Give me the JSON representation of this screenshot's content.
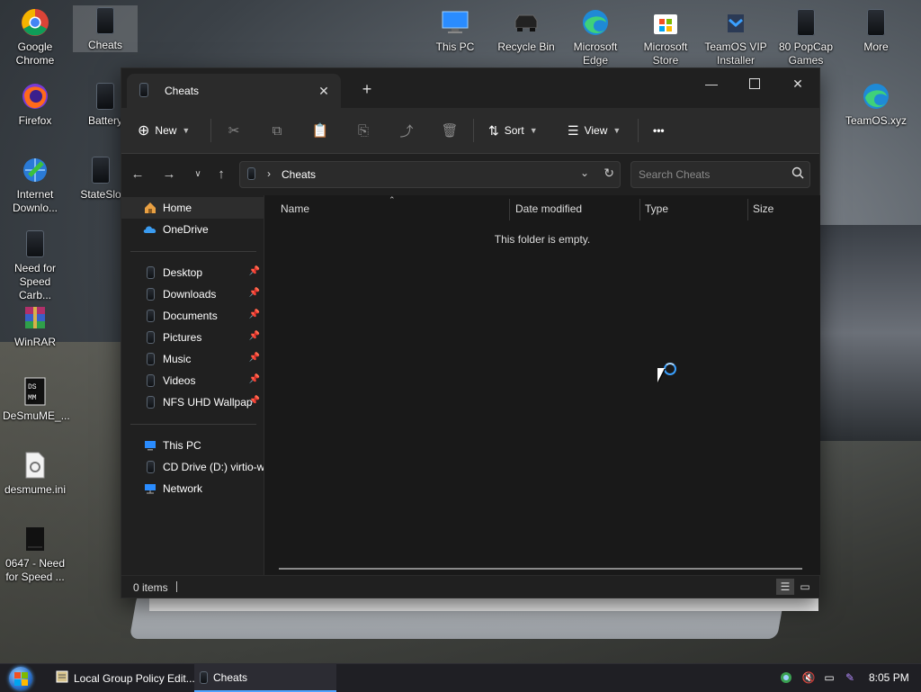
{
  "desktop": {
    "icons": [
      {
        "label": "Google\nChrome"
      },
      {
        "label": "Cheats"
      },
      {
        "label": "Firefox"
      },
      {
        "label": "Battery"
      },
      {
        "label": "Internet\nDownlo..."
      },
      {
        "label": "StateSlo"
      },
      {
        "label": "Need for\nSpeed Carb..."
      },
      {
        "label": "WinRAR"
      },
      {
        "label": "DeSmuME_..."
      },
      {
        "label": "desmume.ini"
      },
      {
        "label": "0647 - Need\nfor Speed ..."
      },
      {
        "label": "This PC"
      },
      {
        "label": "Recycle Bin"
      },
      {
        "label": "Microsoft\nEdge"
      },
      {
        "label": "Microsoft\nStore"
      },
      {
        "label": "TeamOS VIP\nInstaller"
      },
      {
        "label": "80 PopCap\nGames"
      },
      {
        "label": "More"
      },
      {
        "label": "TeamOS.xyz"
      }
    ]
  },
  "explorer": {
    "tab_title": "Cheats",
    "toolbar": {
      "new_label": "New",
      "sort_label": "Sort",
      "view_label": "View",
      "more_label": "•••"
    },
    "address": {
      "path": "Cheats",
      "search_placeholder": "Search Cheats"
    },
    "nav": {
      "quick": [
        {
          "label": "Home"
        },
        {
          "label": "OneDrive"
        }
      ],
      "pinned": [
        {
          "label": "Desktop"
        },
        {
          "label": "Downloads"
        },
        {
          "label": "Documents"
        },
        {
          "label": "Pictures"
        },
        {
          "label": "Music"
        },
        {
          "label": "Videos"
        },
        {
          "label": "NFS UHD Wallpap"
        }
      ],
      "locations": [
        {
          "label": "This PC"
        },
        {
          "label": "CD Drive (D:) virtio-w"
        },
        {
          "label": "Network"
        }
      ]
    },
    "columns": {
      "name": "Name",
      "date_modified": "Date modified",
      "type": "Type",
      "size": "Size"
    },
    "empty_message": "This folder is empty.",
    "status": {
      "items": "0 items"
    }
  },
  "taskbar": {
    "tasks": [
      {
        "label": "Local Group Policy Edit..."
      },
      {
        "label": "Cheats"
      }
    ],
    "clock": "8:05 PM"
  },
  "colors": {
    "accent": "#4fa3ff",
    "window_bg": "#191919",
    "toolbar_bg": "#2b2b2b"
  }
}
